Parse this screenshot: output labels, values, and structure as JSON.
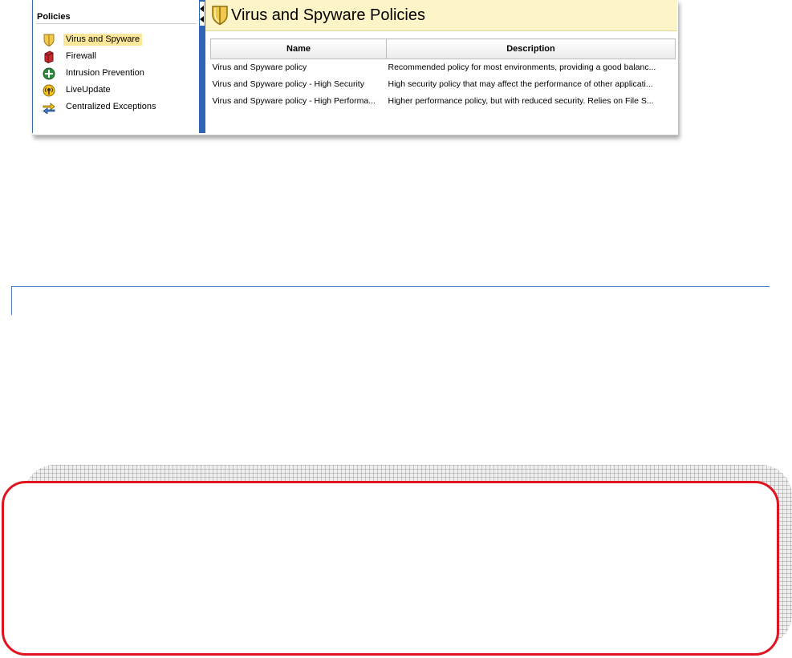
{
  "sidebar": {
    "title": "Policies",
    "items": [
      {
        "label": "Virus and Spyware",
        "icon": "shield-icon",
        "selected": true
      },
      {
        "label": "Firewall",
        "icon": "firewall-icon",
        "selected": false
      },
      {
        "label": "Intrusion Prevention",
        "icon": "intrusion-prevention-icon",
        "selected": false
      },
      {
        "label": "LiveUpdate",
        "icon": "liveupdate-icon",
        "selected": false
      },
      {
        "label": "Centralized Exceptions",
        "icon": "exceptions-icon",
        "selected": false
      }
    ]
  },
  "main": {
    "title": "Virus and Spyware Policies",
    "title_icon": "shield-icon",
    "table": {
      "columns": [
        "Name",
        "Description"
      ],
      "rows": [
        {
          "name": "Virus and Spyware policy",
          "description": "Recommended policy for most environments, providing a good balanc..."
        },
        {
          "name": "Virus and Spyware policy - High Security",
          "description": "High security policy that may affect the performance of other applicati..."
        },
        {
          "name": "Virus and Spyware policy - High Performa...",
          "description": "Higher performance policy, but with reduced security. Relies on File S..."
        }
      ]
    }
  },
  "colors": {
    "header_background": "#fdf4c7",
    "selection_highlight": "#fce79a",
    "splitter": "#2f64b4",
    "divider_line": "#4f81bd",
    "callout_border": "#e0141e"
  }
}
